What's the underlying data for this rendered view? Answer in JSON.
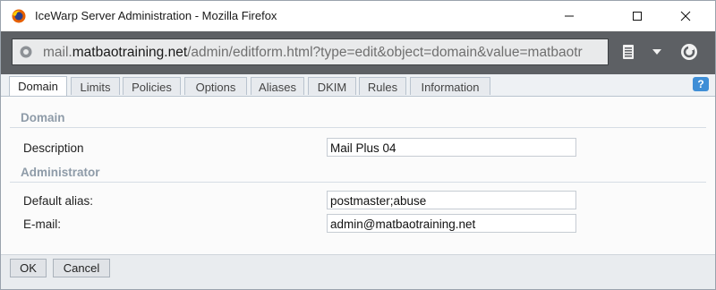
{
  "window": {
    "title": "IceWarp Server Administration - Mozilla Firefox",
    "browser_icon": "firefox-icon",
    "controls": [
      "minimize-icon",
      "maximize-icon",
      "close-icon"
    ]
  },
  "urlbar": {
    "url_prefix": "mail.",
    "url_domain": "matbaotraining.net",
    "url_path": "/admin/editform.html?type=edit&object=domain&value=matbaotr",
    "icons": [
      "globe-icon",
      "reader-icon",
      "dropdown-icon",
      "sync-icon"
    ]
  },
  "tabs": [
    {
      "label": "Domain",
      "active": true
    },
    {
      "label": "Limits",
      "active": false
    },
    {
      "label": "Policies",
      "active": false
    },
    {
      "label": "Options",
      "active": false
    },
    {
      "label": "Aliases",
      "active": false
    },
    {
      "label": "DKIM",
      "active": false
    },
    {
      "label": "Rules",
      "active": false
    },
    {
      "label": "Information",
      "active": false
    }
  ],
  "help_label": "?",
  "form": {
    "domain_section": "Domain",
    "description_label": "Description",
    "description_value": "Mail Plus 04",
    "admin_section": "Administrator",
    "alias_label": "Default alias:",
    "alias_value": "postmaster;abuse",
    "email_label": "E-mail:",
    "email_value": "admin@matbaotraining.net"
  },
  "buttons": {
    "ok": "OK",
    "cancel": "Cancel"
  },
  "colors": {
    "urlbar_bg": "#5d6064",
    "section_text": "#8e9ba8",
    "help_badge": "#3f8ed6"
  }
}
